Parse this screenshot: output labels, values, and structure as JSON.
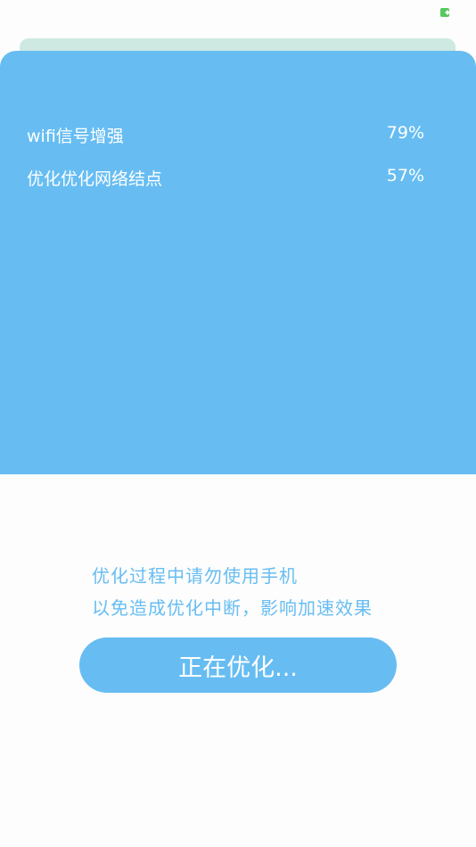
{
  "colors": {
    "primary": "#67bdf2",
    "back_card": "#cde9e2",
    "battery": "#57c75f"
  },
  "status_bar": {
    "icons": [
      "battery-icon"
    ]
  },
  "tasks": [
    {
      "label": "wifi信号增强",
      "percent": "79%",
      "progress": 0.79
    },
    {
      "label": "优化优化网络结点",
      "percent": "57%",
      "progress": 0.57
    }
  ],
  "hint": {
    "line1": "优化过程中请勿使用手机",
    "line2": "以免造成优化中断，影响加速效果"
  },
  "button": {
    "label": "正在优化..."
  }
}
